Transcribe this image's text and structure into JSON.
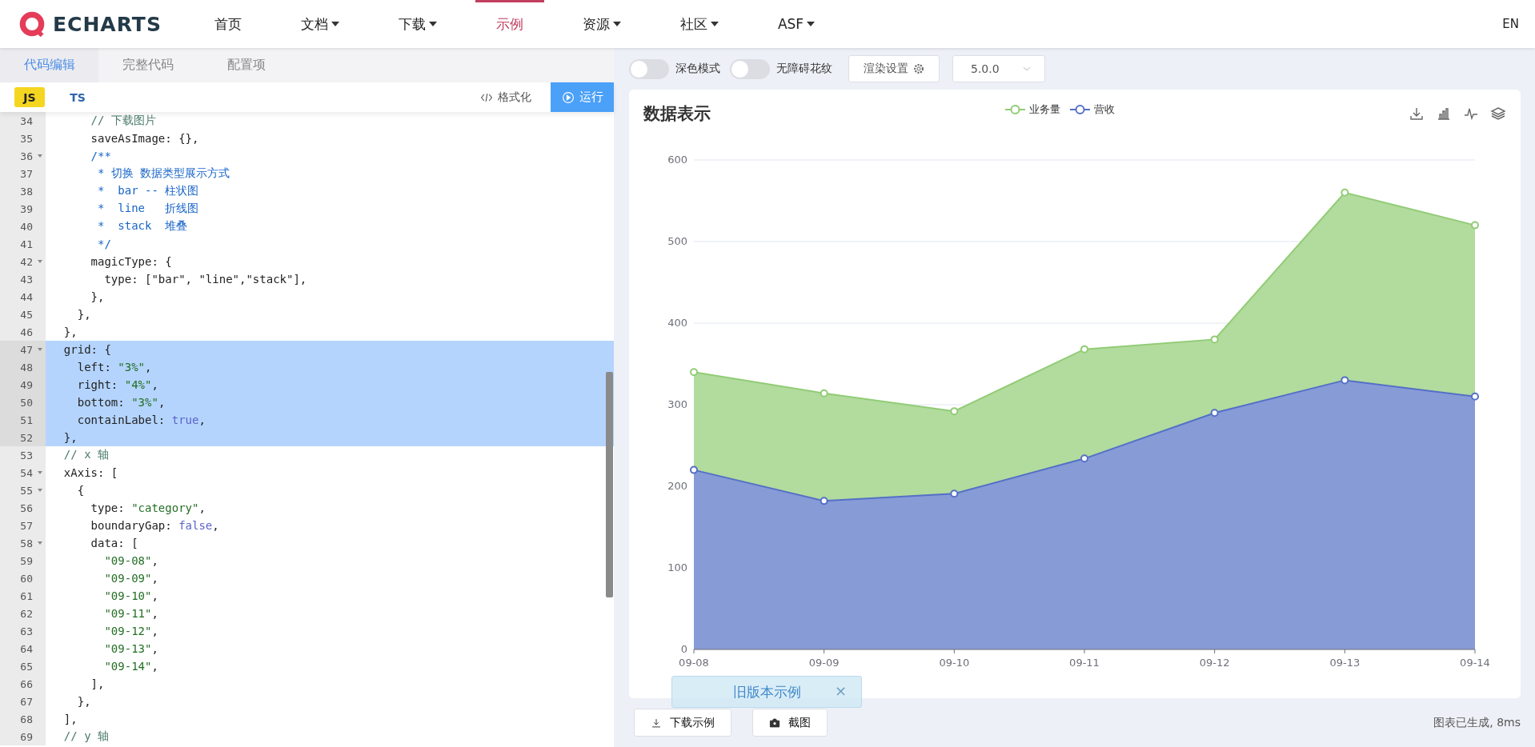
{
  "nav": {
    "logo": "ECHARTS",
    "items": [
      {
        "label": "首页",
        "dropdown": false,
        "selected": false
      },
      {
        "label": "文档",
        "dropdown": true,
        "selected": false
      },
      {
        "label": "下载",
        "dropdown": true,
        "selected": false
      },
      {
        "label": "示例",
        "dropdown": false,
        "selected": true
      },
      {
        "label": "资源",
        "dropdown": true,
        "selected": false
      },
      {
        "label": "社区",
        "dropdown": true,
        "selected": false
      },
      {
        "label": "ASF",
        "dropdown": true,
        "selected": false
      }
    ],
    "language": "EN"
  },
  "editor": {
    "tabs": [
      {
        "label": "代码编辑",
        "selected": true
      },
      {
        "label": "完整代码",
        "selected": false
      },
      {
        "label": "配置项",
        "selected": false
      }
    ],
    "languages": [
      {
        "label": "JS",
        "selected": true
      },
      {
        "label": "TS",
        "selected": false
      }
    ],
    "format_button": "格式化",
    "run_button": "运行",
    "lines": [
      {
        "number": "34",
        "foldable": false,
        "selected": false,
        "segments": [
          {
            "kind": "comment",
            "text": "      // 下载图片"
          }
        ]
      },
      {
        "number": "35",
        "foldable": false,
        "selected": false,
        "segments": [
          {
            "kind": "plain",
            "text": "      saveAsImage: {},"
          }
        ]
      },
      {
        "number": "36",
        "foldable": true,
        "selected": false,
        "segments": [
          {
            "kind": "doc",
            "text": "      /**"
          }
        ]
      },
      {
        "number": "37",
        "foldable": false,
        "selected": false,
        "segments": [
          {
            "kind": "doc",
            "text": "       * 切换 数据类型展示方式"
          }
        ]
      },
      {
        "number": "38",
        "foldable": false,
        "selected": false,
        "segments": [
          {
            "kind": "doc",
            "text": "       *  bar -- 柱状图"
          }
        ]
      },
      {
        "number": "39",
        "foldable": false,
        "selected": false,
        "segments": [
          {
            "kind": "doc",
            "text": "       *  line   折线图"
          }
        ]
      },
      {
        "number": "40",
        "foldable": false,
        "selected": false,
        "segments": [
          {
            "kind": "doc",
            "text": "       *  stack  堆叠"
          }
        ]
      },
      {
        "number": "41",
        "foldable": false,
        "selected": false,
        "segments": [
          {
            "kind": "doc",
            "text": "       */"
          }
        ]
      },
      {
        "number": "42",
        "foldable": true,
        "selected": false,
        "segments": [
          {
            "kind": "plain",
            "text": "      magicType: {"
          }
        ]
      },
      {
        "number": "43",
        "foldable": false,
        "selected": false,
        "segments": [
          {
            "kind": "plain",
            "text": "        type: [\"bar\", \"line\",\"stack\"],"
          }
        ]
      },
      {
        "number": "44",
        "foldable": false,
        "selected": false,
        "segments": [
          {
            "kind": "plain",
            "text": "      },"
          }
        ]
      },
      {
        "number": "45",
        "foldable": false,
        "selected": false,
        "segments": [
          {
            "kind": "plain",
            "text": "    },"
          }
        ]
      },
      {
        "number": "46",
        "foldable": false,
        "selected": false,
        "segments": [
          {
            "kind": "plain",
            "text": "  },"
          }
        ]
      },
      {
        "number": "47",
        "foldable": true,
        "selected": true,
        "segments": [
          {
            "kind": "plain",
            "text": "  grid: {"
          }
        ]
      },
      {
        "number": "48",
        "foldable": false,
        "selected": true,
        "segments": [
          {
            "kind": "plain",
            "text": "    left: "
          },
          {
            "kind": "string",
            "text": "\"3%\""
          },
          {
            "kind": "plain",
            "text": ","
          }
        ]
      },
      {
        "number": "49",
        "foldable": false,
        "selected": true,
        "segments": [
          {
            "kind": "plain",
            "text": "    right: "
          },
          {
            "kind": "string",
            "text": "\"4%\""
          },
          {
            "kind": "plain",
            "text": ","
          }
        ]
      },
      {
        "number": "50",
        "foldable": false,
        "selected": true,
        "segments": [
          {
            "kind": "plain",
            "text": "    bottom: "
          },
          {
            "kind": "string",
            "text": "\"3%\""
          },
          {
            "kind": "plain",
            "text": ","
          }
        ]
      },
      {
        "number": "51",
        "foldable": false,
        "selected": true,
        "segments": [
          {
            "kind": "plain",
            "text": "    containLabel: "
          },
          {
            "kind": "keyword",
            "text": "true"
          },
          {
            "kind": "plain",
            "text": ","
          }
        ]
      },
      {
        "number": "52",
        "foldable": false,
        "selected": true,
        "segments": [
          {
            "kind": "plain",
            "text": "  },"
          }
        ]
      },
      {
        "number": "53",
        "foldable": false,
        "selected": false,
        "segments": [
          {
            "kind": "comment",
            "text": "  // x 轴"
          }
        ]
      },
      {
        "number": "54",
        "foldable": true,
        "selected": false,
        "segments": [
          {
            "kind": "plain",
            "text": "  xAxis: ["
          }
        ]
      },
      {
        "number": "55",
        "foldable": true,
        "selected": false,
        "segments": [
          {
            "kind": "plain",
            "text": "    {"
          }
        ]
      },
      {
        "number": "56",
        "foldable": false,
        "selected": false,
        "segments": [
          {
            "kind": "plain",
            "text": "      type: "
          },
          {
            "kind": "string",
            "text": "\"category\""
          },
          {
            "kind": "plain",
            "text": ","
          }
        ]
      },
      {
        "number": "57",
        "foldable": false,
        "selected": false,
        "segments": [
          {
            "kind": "plain",
            "text": "      boundaryGap: "
          },
          {
            "kind": "keyword",
            "text": "false"
          },
          {
            "kind": "plain",
            "text": ","
          }
        ]
      },
      {
        "number": "58",
        "foldable": true,
        "selected": false,
        "segments": [
          {
            "kind": "plain",
            "text": "      data: ["
          }
        ]
      },
      {
        "number": "59",
        "foldable": false,
        "selected": false,
        "segments": [
          {
            "kind": "string",
            "text": "        \"09-08\""
          },
          {
            "kind": "plain",
            "text": ","
          }
        ]
      },
      {
        "number": "60",
        "foldable": false,
        "selected": false,
        "segments": [
          {
            "kind": "string",
            "text": "        \"09-09\""
          },
          {
            "kind": "plain",
            "text": ","
          }
        ]
      },
      {
        "number": "61",
        "foldable": false,
        "selected": false,
        "segments": [
          {
            "kind": "string",
            "text": "        \"09-10\""
          },
          {
            "kind": "plain",
            "text": ","
          }
        ]
      },
      {
        "number": "62",
        "foldable": false,
        "selected": false,
        "segments": [
          {
            "kind": "string",
            "text": "        \"09-11\""
          },
          {
            "kind": "plain",
            "text": ","
          }
        ]
      },
      {
        "number": "63",
        "foldable": false,
        "selected": false,
        "segments": [
          {
            "kind": "string",
            "text": "        \"09-12\""
          },
          {
            "kind": "plain",
            "text": ","
          }
        ]
      },
      {
        "number": "64",
        "foldable": false,
        "selected": false,
        "segments": [
          {
            "kind": "string",
            "text": "        \"09-13\""
          },
          {
            "kind": "plain",
            "text": ","
          }
        ]
      },
      {
        "number": "65",
        "foldable": false,
        "selected": false,
        "segments": [
          {
            "kind": "string",
            "text": "        \"09-14\""
          },
          {
            "kind": "plain",
            "text": ","
          }
        ]
      },
      {
        "number": "66",
        "foldable": false,
        "selected": false,
        "segments": [
          {
            "kind": "plain",
            "text": "      ],"
          }
        ]
      },
      {
        "number": "67",
        "foldable": false,
        "selected": false,
        "segments": [
          {
            "kind": "plain",
            "text": "    },"
          }
        ]
      },
      {
        "number": "68",
        "foldable": false,
        "selected": false,
        "segments": [
          {
            "kind": "plain",
            "text": "  ],"
          }
        ]
      },
      {
        "number": "69",
        "foldable": false,
        "selected": false,
        "segments": [
          {
            "kind": "comment",
            "text": "  // y 轴"
          }
        ]
      }
    ]
  },
  "toolbar": {
    "switches": [
      {
        "label": "深色模式",
        "on": false
      },
      {
        "label": "无障碍花纹",
        "on": false
      }
    ],
    "render_settings": "渲染设置",
    "version": "5.0.0"
  },
  "chart": {
    "title": "数据表示",
    "chart_data": {
      "type": "area",
      "categories": [
        "09-08",
        "09-09",
        "09-10",
        "09-11",
        "09-12",
        "09-13",
        "09-14"
      ],
      "series": [
        {
          "name": "业务量",
          "color": "#91cc75",
          "values": [
            340,
            314,
            292,
            368,
            380,
            560,
            520
          ]
        },
        {
          "name": "营收",
          "color": "#5470c6",
          "values": [
            220,
            182,
            191,
            234,
            290,
            330,
            310
          ]
        }
      ],
      "stacked": false,
      "grid": true,
      "ylim": [
        0,
        600
      ],
      "yticks": [
        0,
        100,
        200,
        300,
        400,
        500,
        600
      ]
    }
  },
  "footer": {
    "buttons": [
      {
        "label": "下载示例",
        "kind": "download"
      },
      {
        "label": "截图",
        "kind": "screenshot"
      }
    ],
    "status": "图表已生成, 8ms"
  },
  "toast": {
    "text": "旧版本示例",
    "close": "×"
  }
}
